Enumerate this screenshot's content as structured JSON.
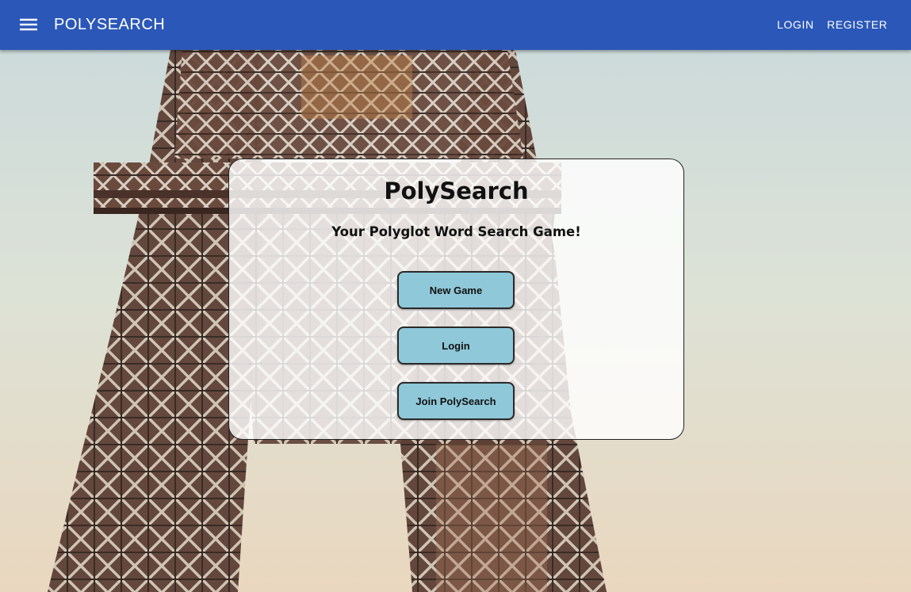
{
  "appbar": {
    "menu_icon": "menu-icon",
    "brand": "POLYSEARCH",
    "login_label": "LOGIN",
    "register_label": "REGISTER",
    "color": "#2b57b8"
  },
  "card": {
    "title": "PolySearch",
    "subtitle": "Your Polyglot Word Search Game!",
    "buttons": [
      {
        "label": "New Game"
      },
      {
        "label": "Login"
      },
      {
        "label": "Join PolySearch"
      }
    ],
    "button_color": "#8fc8d8"
  },
  "background": {
    "subject": "eiffel-tower-photo"
  }
}
